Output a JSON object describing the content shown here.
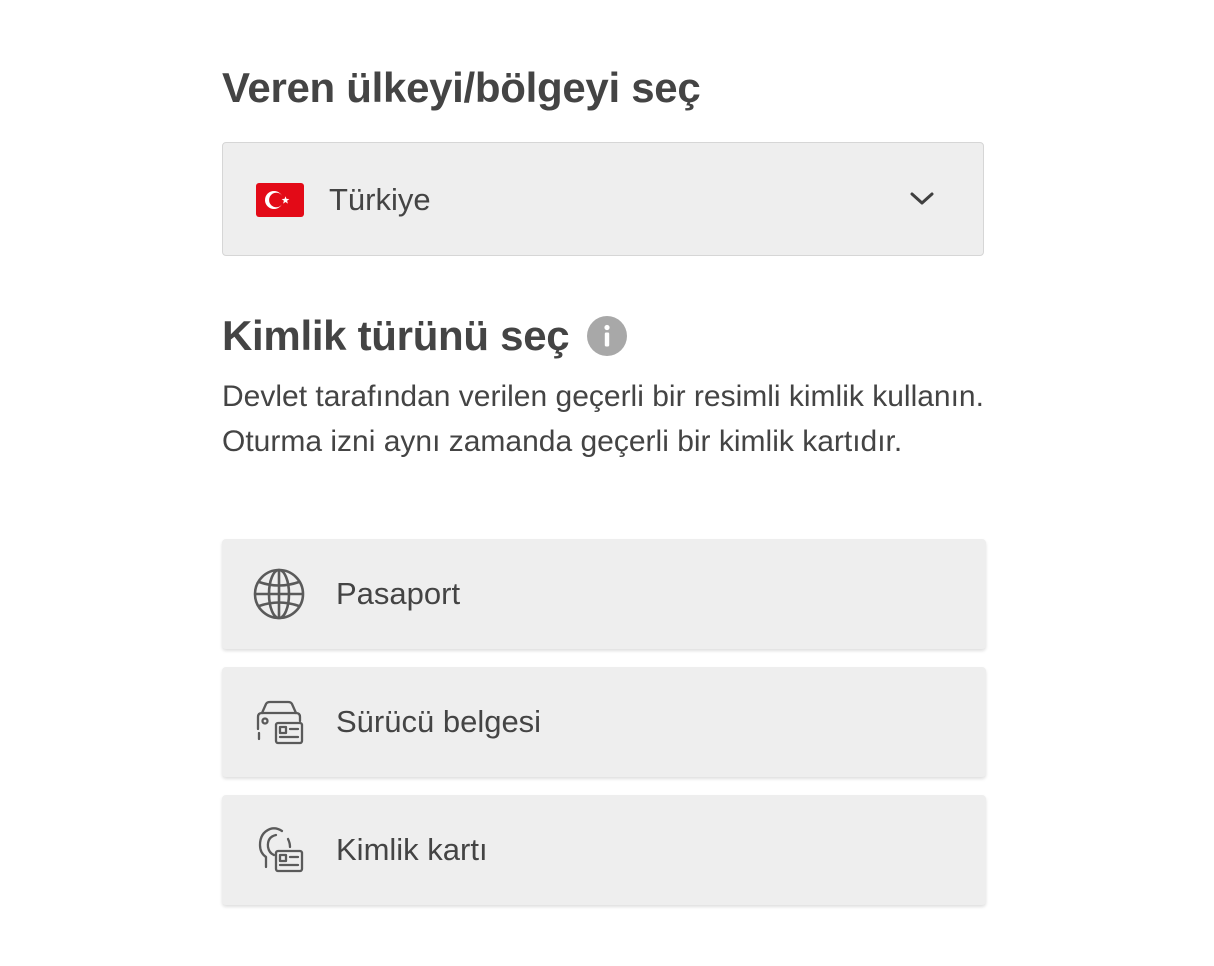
{
  "country_section": {
    "title": "Veren ülkeyi/bölgeyi seç",
    "selected_country": "Türkiye",
    "flag_icon": "turkey-flag-icon",
    "dropdown_icon": "chevron-down-icon"
  },
  "id_section": {
    "title": "Kimlik türünü seç",
    "info_icon": "info-icon",
    "description": "Devlet tarafından verilen geçerli bir resimli kimlik kullanın. Oturma izni aynı zamanda geçerli bir kimlik kartıdır.",
    "options": [
      {
        "label": "Pasaport",
        "icon": "globe-icon"
      },
      {
        "label": "Sürücü belgesi",
        "icon": "car-license-icon"
      },
      {
        "label": "Kimlik kartı",
        "icon": "person-id-card-icon"
      }
    ]
  },
  "colors": {
    "flag_red": "#e30a17",
    "option_background": "#eeeeee",
    "text": "#444444",
    "info_icon_background": "#a8a8a8"
  }
}
